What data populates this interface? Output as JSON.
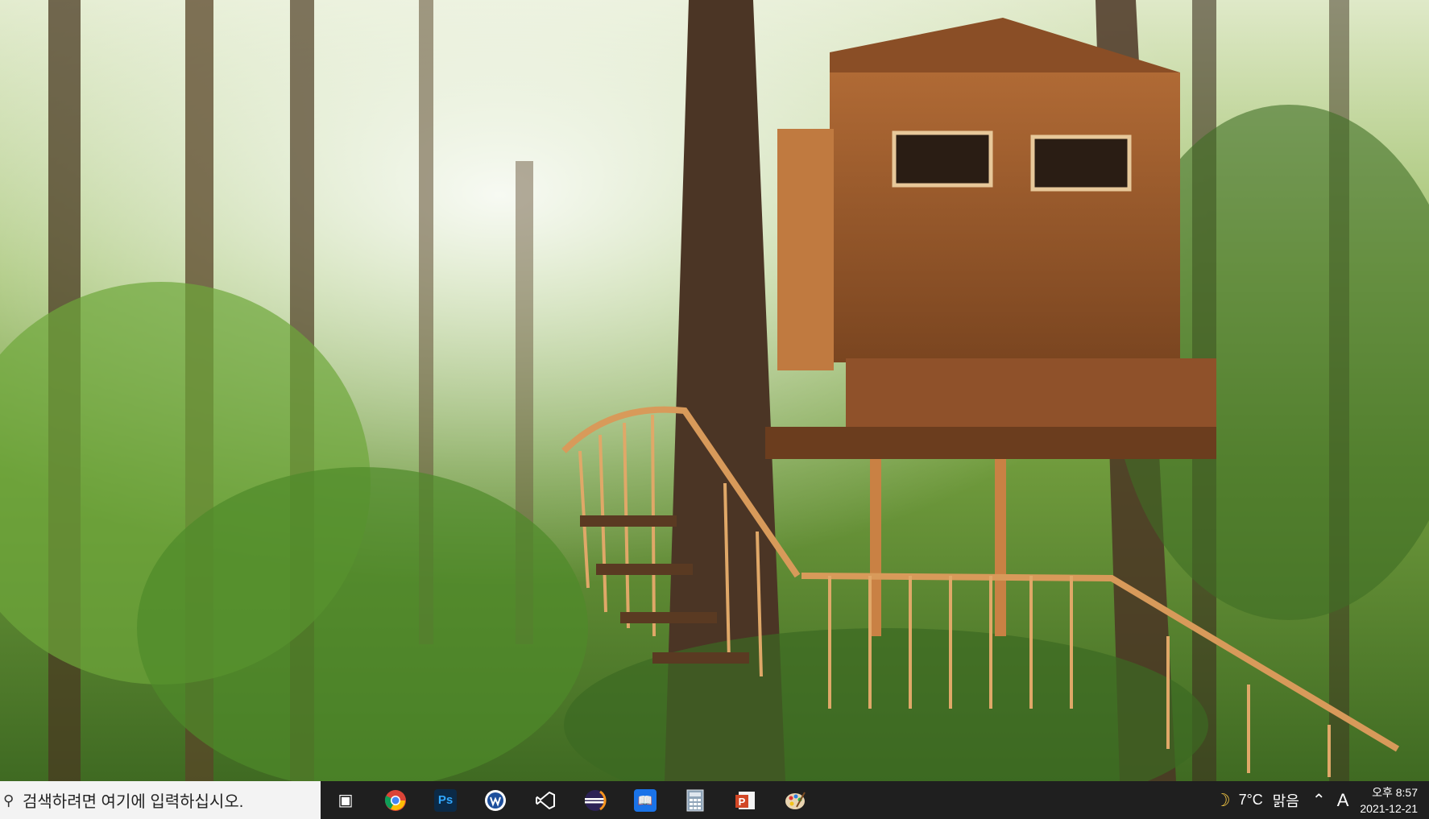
{
  "taskbar": {
    "search_placeholder": "검색하려면 여기에 입력하십시오.",
    "pinned_apps": [
      {
        "name": "task-view",
        "icon": "task-view-icon"
      },
      {
        "name": "chrome",
        "icon": "chrome-icon"
      },
      {
        "name": "photoshop",
        "icon": "photoshop-icon",
        "label": "Ps"
      },
      {
        "name": "app-w",
        "icon": "w-app-icon"
      },
      {
        "name": "visual-studio",
        "icon": "visual-studio-icon"
      },
      {
        "name": "eclipse",
        "icon": "eclipse-icon"
      },
      {
        "name": "reader",
        "icon": "book-icon"
      },
      {
        "name": "calculator",
        "icon": "calculator-icon"
      },
      {
        "name": "powerpoint",
        "icon": "powerpoint-icon"
      },
      {
        "name": "paint",
        "icon": "paint-palette-icon"
      }
    ],
    "weather": {
      "temperature": "7°C",
      "condition": "맑음"
    },
    "input_indicator": "A",
    "clock": {
      "time": "오후 8:57",
      "date": "2021-12-21"
    }
  },
  "colors": {
    "taskbar_bg": "#1f1f1f",
    "search_bg": "#f3f3f3"
  }
}
